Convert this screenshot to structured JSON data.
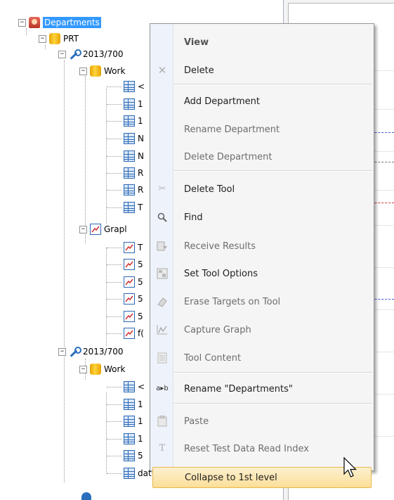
{
  "tree": {
    "root": {
      "label": "Departments"
    },
    "prt": {
      "label": "PRT"
    },
    "tool1": {
      "label": "2013/700"
    },
    "work1": {
      "label": "Work"
    },
    "work1_items": [
      "<",
      "1",
      "1",
      "N",
      "N",
      "R",
      "R",
      "T"
    ],
    "graphs": {
      "label": "Grapl"
    },
    "graph_items": [
      "T",
      "5",
      "5",
      "5",
      "5",
      "f("
    ],
    "tool2": {
      "label": "2013/700"
    },
    "work2": {
      "label": "Work"
    },
    "work2_items": [
      "<",
      "1",
      "1",
      "1",
      "5",
      "dat"
    ]
  },
  "menu": {
    "items": [
      {
        "label": "View",
        "icon": "",
        "style": "bold"
      },
      {
        "label": "Delete",
        "icon": "delete-x-icon",
        "style": "normal"
      },
      {
        "label": "Add Department",
        "icon": "",
        "style": "normal"
      },
      {
        "label": "Rename Department",
        "icon": "",
        "style": "disabled"
      },
      {
        "label": "Delete Department",
        "icon": "",
        "style": "disabled"
      },
      {
        "label": "Delete Tool",
        "icon": "delete-tool-icon",
        "style": "normal"
      },
      {
        "label": "Find",
        "icon": "magnifier-icon",
        "style": "normal"
      },
      {
        "label": "Receive Results",
        "icon": "receive-results-icon",
        "style": "disabled"
      },
      {
        "label": "Set Tool Options",
        "icon": "tool-options-icon",
        "style": "normal"
      },
      {
        "label": "Erase Targets on Tool",
        "icon": "eraser-icon",
        "style": "disabled"
      },
      {
        "label": "Capture Graph",
        "icon": "capture-graph-icon",
        "style": "disabled"
      },
      {
        "label": "Tool Content",
        "icon": "tool-content-icon",
        "style": "disabled"
      },
      {
        "label": "Rename \"Departments\"",
        "icon": "rename-icon",
        "style": "normal"
      },
      {
        "label": "Paste",
        "icon": "paste-icon",
        "style": "disabled"
      },
      {
        "label": "Reset Test Data Read Index",
        "icon": "reset-text-icon",
        "style": "disabled"
      },
      {
        "label": "Collapse to 1st level",
        "icon": "",
        "style": "highlighted"
      }
    ],
    "rename_icon_text": "a▸b"
  },
  "colors": {
    "selection": "#3399ff",
    "menu_highlight": "#fbdf98",
    "dash_blue": "#3b5bdb",
    "dash_red": "#d63b3b"
  }
}
